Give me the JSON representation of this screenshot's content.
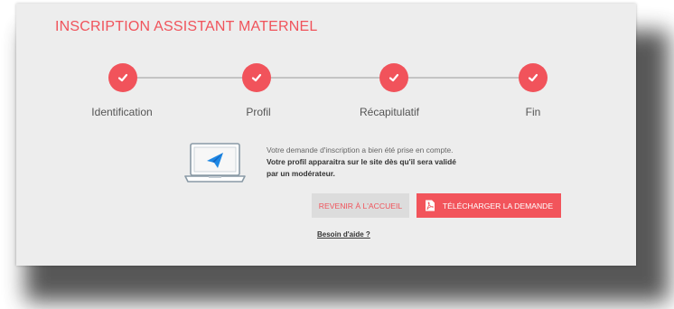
{
  "page": {
    "title": "INSCRIPTION ASSISTANT MATERNEL"
  },
  "steps": [
    {
      "label": "Identification",
      "status": "completed"
    },
    {
      "label": "Profil",
      "status": "completed"
    },
    {
      "label": "Récapitulatif",
      "status": "completed"
    },
    {
      "label": "Fin",
      "status": "completed"
    }
  ],
  "confirmation": {
    "line1": "Votre demande d'inscription a bien été prise en compte.",
    "line2": "Votre profil apparaitra sur le site dès qu'il sera validé",
    "line3": "par un modérateur."
  },
  "actions": {
    "home_label": "REVENIR À L'ACCUEIL",
    "download_label": "TÉLÉCHARGER LA DEMANDE",
    "help_label": "Besoin d'aide ?"
  },
  "colors": {
    "accent": "#f1535b",
    "background": "#ededed",
    "secondary_button": "#dcdcdc"
  },
  "icons": {
    "step": "check-icon",
    "illustration": "laptop-paper-plane-icon",
    "download": "pdf-file-icon"
  }
}
